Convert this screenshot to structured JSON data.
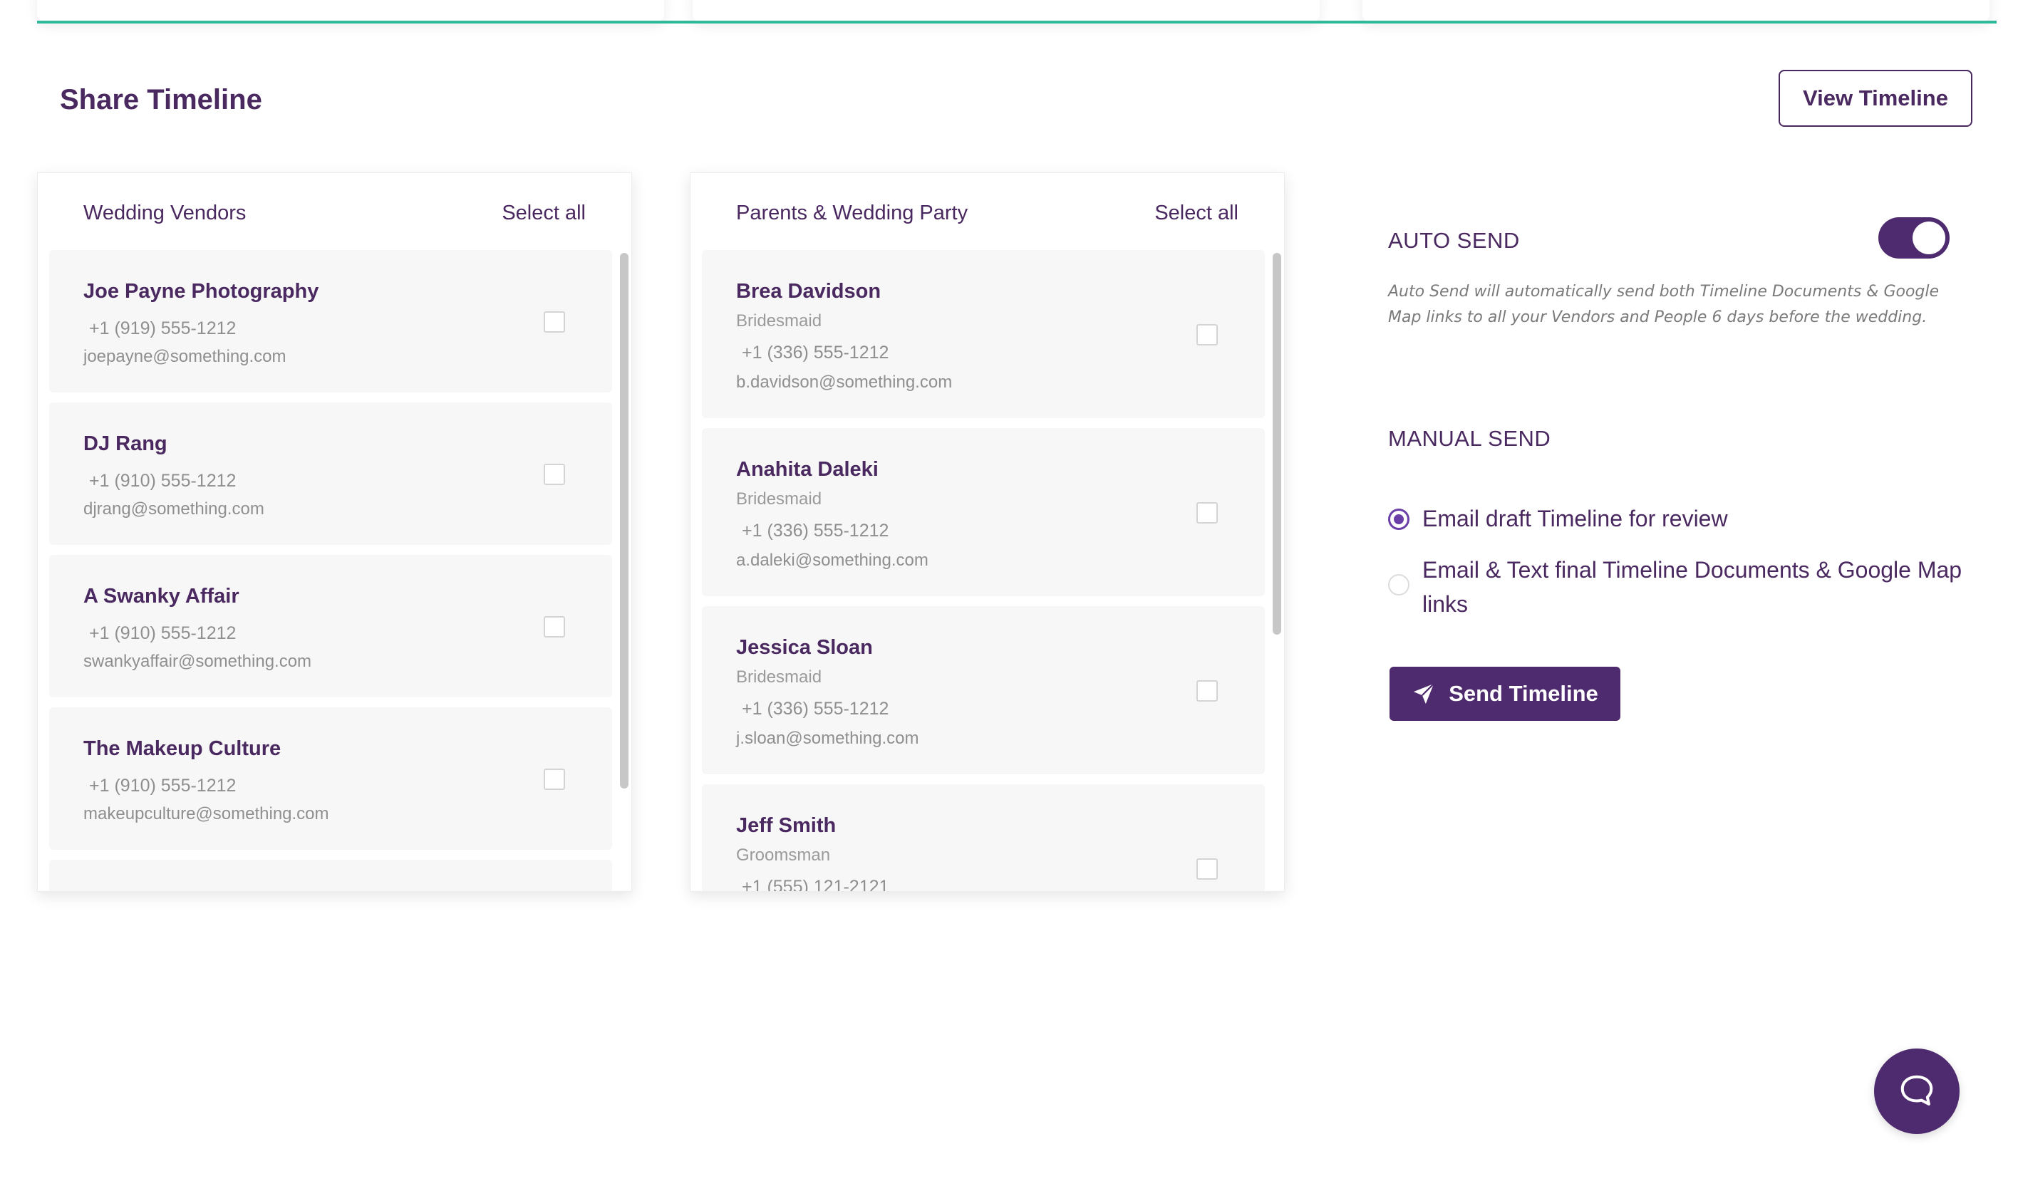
{
  "page": {
    "title": "Share Timeline",
    "view_button": "View Timeline"
  },
  "vendors": {
    "title": "Wedding Vendors",
    "select_all": "Select all",
    "items": [
      {
        "name": "Joe Payne Photography",
        "phone": "+1 (919) 555-1212",
        "email": "joepayne@something.com"
      },
      {
        "name": "DJ Rang",
        "phone": "+1 (910) 555-1212",
        "email": "djrang@something.com"
      },
      {
        "name": "A Swanky Affair",
        "phone": "+1 (910) 555-1212",
        "email": "swankyaffair@something.com"
      },
      {
        "name": "The Makeup Culture",
        "phone": "+1 (910) 555-1212",
        "email": "makeupculture@something.com"
      }
    ]
  },
  "party": {
    "title": "Parents & Wedding Party",
    "select_all": "Select all",
    "items": [
      {
        "name": "Brea Davidson",
        "role": "Bridesmaid",
        "phone": "+1 (336) 555-1212",
        "email": "b.davidson@something.com"
      },
      {
        "name": "Anahita Daleki",
        "role": "Bridesmaid",
        "phone": "+1 (336) 555-1212",
        "email": "a.daleki@something.com"
      },
      {
        "name": "Jessica Sloan",
        "role": "Bridesmaid",
        "phone": "+1 (336) 555-1212",
        "email": "j.sloan@something.com"
      },
      {
        "name": "Jeff Smith",
        "role": "Groomsman",
        "phone": "+1 (555) 121-2121",
        "email": ""
      }
    ]
  },
  "auto_send": {
    "label": "AUTO SEND",
    "enabled": true,
    "description": "Auto Send will automatically send both Timeline Documents & Google Map links to all your Vendors and People 6 days before the wedding."
  },
  "manual_send": {
    "label": "MANUAL SEND",
    "options": [
      {
        "label": "Email draft Timeline for review",
        "selected": true
      },
      {
        "label": "Email & Text final Timeline Documents & Google Map links",
        "selected": false
      }
    ],
    "send_button": "Send Timeline"
  },
  "icons": {
    "send": "paper-plane-icon",
    "chat": "chat-bubble-icon"
  },
  "colors": {
    "brand": "#4e2a6e",
    "accent_line": "#2fb89a",
    "radio_selected": "#6b3fa8"
  }
}
